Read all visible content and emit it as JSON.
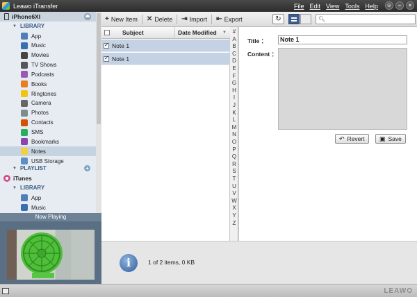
{
  "window": {
    "title": "Leawo iTransfer",
    "menus": [
      "File",
      "Edit",
      "View",
      "Tools",
      "Help"
    ],
    "controls": [
      "☺",
      "–",
      "×"
    ]
  },
  "sidebar": {
    "device": "iPhone6XI",
    "library_header": "LIBRARY",
    "items": [
      {
        "label": "App",
        "icon": "app-icon",
        "color": "#4f7fb8"
      },
      {
        "label": "Music",
        "icon": "music-icon",
        "color": "#3a6fb0"
      },
      {
        "label": "Movies",
        "icon": "movies-icon",
        "color": "#444444"
      },
      {
        "label": "TV Shows",
        "icon": "tv-icon",
        "color": "#555555"
      },
      {
        "label": "Podcasts",
        "icon": "podcast-icon",
        "color": "#9b59b6"
      },
      {
        "label": "Books",
        "icon": "books-icon",
        "color": "#e67e22"
      },
      {
        "label": "Ringtones",
        "icon": "bell-icon",
        "color": "#f1c40f"
      },
      {
        "label": "Camera",
        "icon": "camera-icon",
        "color": "#666666"
      },
      {
        "label": "Photos",
        "icon": "photos-icon",
        "color": "#7f8c8d"
      },
      {
        "label": "Contacts",
        "icon": "contacts-icon",
        "color": "#d35400"
      },
      {
        "label": "SMS",
        "icon": "sms-icon",
        "color": "#27ae60"
      },
      {
        "label": "Bookmarks",
        "icon": "bookmarks-icon",
        "color": "#8e44ad"
      },
      {
        "label": "Notes",
        "icon": "notes-icon",
        "color": "#f4d03f"
      },
      {
        "label": "USB Storage",
        "icon": "usb-icon",
        "color": "#5d8fc4"
      }
    ],
    "selected": "Notes",
    "playlist_header": "PLAYLIST",
    "itunes": "iTunes",
    "itunes_library_header": "LIBRARY",
    "itunes_items": [
      {
        "label": "App",
        "icon": "app-icon",
        "color": "#4f7fb8"
      },
      {
        "label": "Music",
        "icon": "music-icon",
        "color": "#3a6fb0"
      }
    ],
    "now_playing": "Now Playing"
  },
  "toolbar": {
    "new_item": "New Item",
    "delete": "Delete",
    "import": "Import",
    "export": "Export",
    "search_placeholder": ""
  },
  "list": {
    "col_subject": "Subject",
    "col_date": "Date Modified",
    "rows": [
      {
        "subject": "Note 1",
        "checked": true
      },
      {
        "subject": "Note 1",
        "checked": true
      }
    ]
  },
  "alphabet": [
    "#",
    "A",
    "B",
    "C",
    "D",
    "E",
    "F",
    "G",
    "H",
    "I",
    "J",
    "K",
    "L",
    "M",
    "N",
    "O",
    "P",
    "Q",
    "R",
    "S",
    "T",
    "U",
    "V",
    "W",
    "X",
    "Y",
    "Z"
  ],
  "detail": {
    "title_label": "Title ：",
    "title_value": "Note 1",
    "content_label": "Content ：",
    "revert": "Revert",
    "save": "Save"
  },
  "status": {
    "text": "1 of 2 items, 0 KB"
  },
  "brand": "LEAWO"
}
